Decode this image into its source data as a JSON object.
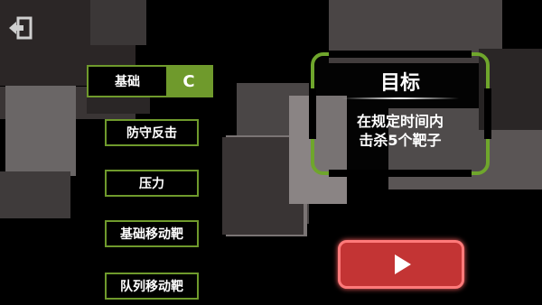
{
  "buttons": {
    "exit": "exit-icon",
    "play": "play-icon"
  },
  "grade": {
    "label": "基础",
    "value": "C"
  },
  "modes": [
    {
      "label": "防守反击"
    },
    {
      "label": "压力"
    },
    {
      "label": "基础移动靶"
    },
    {
      "label": "队列移动靶"
    }
  ],
  "objective": {
    "title": "目标",
    "description": "在规定时间内\n击杀5个靶子"
  },
  "colors": {
    "accent_green": "#6f9a2c",
    "play_red": "#c33434",
    "background": "#000000"
  }
}
